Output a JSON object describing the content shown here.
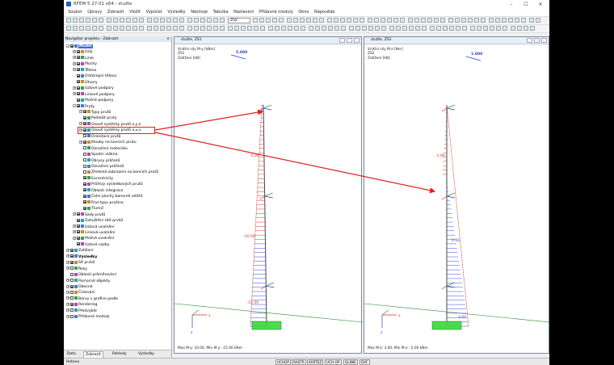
{
  "window": {
    "title": "RFEM 5.27.01 x64 - stužte",
    "min_label": "–",
    "max_label": "☐",
    "close_label": "✕"
  },
  "menu": [
    "Soubor",
    "Úpravy",
    "Zobrazit",
    "Vložit",
    "Výpočet",
    "Výsledky",
    "Nástroje",
    "Tabulka",
    "Nastavení",
    "Přídavné moduly",
    "Okno",
    "Nápověda"
  ],
  "toolbar": {
    "loadcase_value": "ZS2"
  },
  "navigator": {
    "title": "Navigátor projektu - Zobrazit",
    "close": "×",
    "items": [
      {
        "label": "Model",
        "level": 0,
        "exp": "-",
        "cb": true,
        "selected": true,
        "bold": true
      },
      {
        "label": "Uzly",
        "level": 1,
        "exp": "+",
        "cb": true
      },
      {
        "label": "Linie",
        "level": 1,
        "exp": "+",
        "cb": true
      },
      {
        "label": "Plochy",
        "level": 1,
        "exp": "+",
        "cb": true
      },
      {
        "label": "Tělesa",
        "level": 1,
        "exp": "+",
        "cb": true
      },
      {
        "label": "Ortotropní tělesa",
        "level": 1,
        "exp": "",
        "cb": true
      },
      {
        "label": "Otvory",
        "level": 1,
        "exp": "",
        "cb": true
      },
      {
        "label": "Uzlové podpory",
        "level": 1,
        "exp": "+",
        "cb": true
      },
      {
        "label": "Liniové podpory",
        "level": 1,
        "exp": "+",
        "cb": true
      },
      {
        "label": "Plošné podpory",
        "level": 1,
        "exp": "",
        "cb": true
      },
      {
        "label": "Pruty",
        "level": 1,
        "exp": "-",
        "cb": true
      },
      {
        "label": "Typy prutů",
        "level": 2,
        "exp": "+",
        "cb": true
      },
      {
        "label": "Podložit pruty",
        "level": 2,
        "exp": "",
        "cb": true
      },
      {
        "label": "Osové systémy prutů x,y,z",
        "level": 2,
        "exp": "+",
        "cb": true
      },
      {
        "label": "Osové systémy prutů x,u,v",
        "level": 2,
        "exp": "+",
        "cb": true
      },
      {
        "label": "Orientace prutů",
        "level": 2,
        "exp": "",
        "cb": false
      },
      {
        "label": "Klouby na koncích prutu",
        "level": 2,
        "exp": "+",
        "cb": true
      },
      {
        "label": "Označení materiálu",
        "level": 2,
        "exp": "",
        "cb": false
      },
      {
        "label": "Spodní vlákna",
        "level": 2,
        "exp": "",
        "cb": false
      },
      {
        "label": "Obrysy průřezů",
        "level": 2,
        "exp": "",
        "cb": false
      },
      {
        "label": "Označení průřezů",
        "level": 2,
        "exp": "",
        "cb": false
      },
      {
        "label": "Zřetelné zobrazení na koncích prutů",
        "level": 2,
        "exp": "",
        "cb": false
      },
      {
        "label": "Excentricity",
        "level": 2,
        "exp": "",
        "cb": true
      },
      {
        "label": "Průřezy výsledkových prutů",
        "level": 2,
        "exp": "",
        "cb": true
      },
      {
        "label": "Oblasti integrace",
        "level": 2,
        "exp": "",
        "cb": true
      },
      {
        "label": "Čelní plochy barevně odlišit",
        "level": 2,
        "exp": "",
        "cb": true
      },
      {
        "label": "Prut typu pružina",
        "level": 2,
        "exp": "",
        "cb": true
      },
      {
        "label": "Tlumič",
        "level": 2,
        "exp": "",
        "cb": true
      },
      {
        "label": "Sady prutů",
        "level": 1,
        "exp": "+",
        "cb": true
      },
      {
        "label": "Zahuštění sítě prvků",
        "level": 1,
        "exp": "",
        "cb": true
      },
      {
        "label": "Uzlová uvolnění",
        "level": 1,
        "exp": "+",
        "cb": true
      },
      {
        "label": "Liniová uvolnění",
        "level": 1,
        "exp": "+",
        "cb": true
      },
      {
        "label": "Plošná uvolnění",
        "level": 1,
        "exp": "+",
        "cb": true
      },
      {
        "label": "Uzlové vazby",
        "level": 1,
        "exp": "",
        "cb": true
      },
      {
        "label": "Zatížení",
        "level": 0,
        "exp": "+",
        "cb": true
      },
      {
        "label": "Výsledky",
        "level": 0,
        "exp": "+",
        "cb": true,
        "bold": true
      },
      {
        "label": "Síť prvků",
        "level": 0,
        "exp": "+",
        "cb": true
      },
      {
        "label": "Řezy",
        "level": 0,
        "exp": "+",
        "cb": false
      },
      {
        "label": "Oblasti průměrování",
        "level": 0,
        "exp": "",
        "cb": false
      },
      {
        "label": "Pomocné objekty",
        "level": 0,
        "exp": "+",
        "cb": false
      },
      {
        "label": "Obecné",
        "level": 0,
        "exp": "+",
        "cb": true
      },
      {
        "label": "Čislování",
        "level": 0,
        "exp": "+",
        "cb": false
      },
      {
        "label": "Barvy v grafice podle",
        "level": 0,
        "exp": "+",
        "cb": false
      },
      {
        "label": "Rendering",
        "level": 0,
        "exp": "+",
        "cb": true
      },
      {
        "label": "Předvýběr",
        "level": 0,
        "exp": "+",
        "cb": false
      },
      {
        "label": "Přídavné moduly",
        "level": 0,
        "exp": "+",
        "cb": false
      }
    ],
    "tabs": [
      "Data",
      "Zobrazit",
      "Pohledy",
      "Výsledky"
    ]
  },
  "panes": [
    {
      "title": "stužte, ZS1",
      "info": [
        "Vnitřní síly M-y [kNm]",
        "ZS1",
        "Zatížení [kN]"
      ],
      "scale_value": "5.000",
      "footer": "Max M-y: 10.00, Min M-y: -15.00 kNm",
      "labels": [
        "-5.00",
        "-10.00",
        "-15.00"
      ]
    },
    {
      "title": "stužte, ZS2",
      "info": [
        "Vnitřní síly M-z [Nm]",
        "ZS2",
        "Zatížení [kN]"
      ],
      "scale_value": "1.000",
      "footer": "Max M-z: 3.00, Min M-z: -2.00 kNm",
      "labels": [
        "-1.00",
        "2.00",
        "3.00"
      ]
    }
  ],
  "axis_letters": {
    "x": "x",
    "y": "y",
    "z": "z"
  },
  "status": {
    "ready": "Hotovo",
    "buttons": [
      "UCHOP",
      "RASTR",
      "KARTEZ",
      "UCH-OP",
      "GLINIE",
      "DXF"
    ]
  }
}
